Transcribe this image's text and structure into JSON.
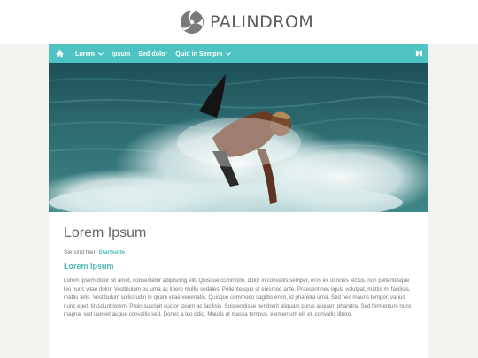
{
  "header": {
    "logo_text": "PALINDROM"
  },
  "nav": {
    "items": [
      {
        "label": "Lorem",
        "has_dropdown": true
      },
      {
        "label": "Ipsum",
        "has_dropdown": false
      },
      {
        "label": "Sed dolor",
        "has_dropdown": false
      },
      {
        "label": "Quid in Sempra",
        "has_dropdown": true
      }
    ],
    "home_icon": "home-icon",
    "search_icon": "search-icon",
    "accent_color": "#4fc3c3"
  },
  "hero": {
    "image": "surfer-wave-photo"
  },
  "content": {
    "title": "Lorem Ipsum",
    "breadcrumb_prefix": "Sie sind hier:",
    "breadcrumb_link": "Startseite",
    "subtitle": "Lorem Ipsum",
    "paragraph": "Lorem ipsum dolor sit amet, consectetur adipiscing elit. Quisque commodo, dolor in convallis semper, eros ex ultricies lectus, non pellentesque leo nunc vitae dolor. Vestibulum eu urna ac libero mollis sodales. Pellentesque ut euismod ante. Praesent nec ligula volutpat, mattis mi facilisis, mattis felis. Vestibulum sollicitudin in quam vitae venenatis. Quisque commodo sagittis enim, id pharetra urna. Sed nec mauris tempor, varius nunc eget, tincidunt lorem. Proin suscipit auctor ipsum ac facilisis. Suspendisse hendrerit aliquam purus aliquam pharetra. Sed fermentum nunc magna, sed laoreet augue convallis sed. Donec a leo odio. Mauris ut massa tempus, elementum elit et, convallis libero."
  }
}
